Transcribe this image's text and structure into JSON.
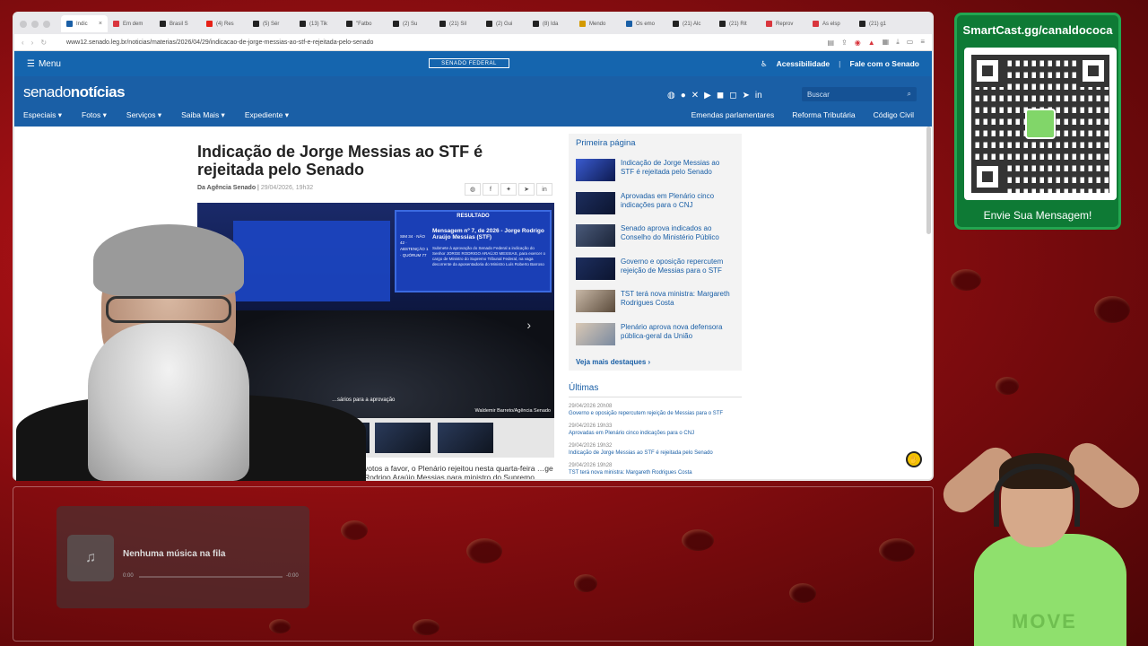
{
  "browser": {
    "tabs": [
      {
        "label": "Indic",
        "color": "#1a5fa6",
        "active": true
      },
      {
        "label": "Em dem",
        "color": "#d9363e"
      },
      {
        "label": "Brasil S",
        "color": "#222"
      },
      {
        "label": "(4) Res",
        "color": "#e62117"
      },
      {
        "label": "(5) Sér",
        "color": "#222"
      },
      {
        "label": "(13) Tik",
        "color": "#222"
      },
      {
        "label": "\"Fatbo",
        "color": "#222"
      },
      {
        "label": "(2) Su",
        "color": "#222"
      },
      {
        "label": "(21) Sil",
        "color": "#222"
      },
      {
        "label": "(2) Gui",
        "color": "#222"
      },
      {
        "label": "(8) Ida",
        "color": "#222"
      },
      {
        "label": "Mendo",
        "color": "#d49a00"
      },
      {
        "label": "Os emo",
        "color": "#1a5fa6"
      },
      {
        "label": "(21) Alc",
        "color": "#222"
      },
      {
        "label": "(21) Rit",
        "color": "#222"
      },
      {
        "label": "Reprov",
        "color": "#d9363e"
      },
      {
        "label": "As elsp",
        "color": "#d9363e"
      },
      {
        "label": "(21) g1",
        "color": "#222"
      }
    ],
    "tab_close": "×",
    "url": "www12.senado.leg.br/noticias/materias/2026/04/29/indicacao-de-jorge-messias-ao-stf-e-rejeitada-pelo-senado"
  },
  "senado": {
    "menu_label": "Menu",
    "center_logo": "SENADO FEDERAL",
    "accessibility": "Acessibilidade",
    "contact": "Fale com o Senado",
    "brand_left": "senado",
    "brand_right": "notícias",
    "nav_left": [
      "Especiais ▾",
      "Fotos ▾",
      "Serviços ▾",
      "Saiba Mais ▾",
      "Expediente ▾"
    ],
    "nav_right": [
      "Emendas parlamentares",
      "Reforma Tributária",
      "Código Civil"
    ],
    "search_placeholder": "Buscar",
    "social_icons": [
      "whatsapp-icon",
      "facebook-icon",
      "x-icon",
      "youtube-icon",
      "flickr-icon",
      "instagram-icon",
      "telegram-icon",
      "linkedin-icon"
    ]
  },
  "article": {
    "headline": "Indicação de Jorge Messias ao STF é rejeitada pelo Senado",
    "byline_source": "Da Agência Senado",
    "byline_date": "29/04/2026, 19h32",
    "photo_screen_title": "RESULTADO",
    "photo_screen_message": "Mensagem nº 7, de 2026 - Jorge Rodrigo Araújo Messias (STF)",
    "photo_screen_body": "Submete à aprovação do Senado Federal a indicação do Senhor JORGE RODRIGO ARAÚJO MESSIAS, para exercer o cargo de Ministro do Supremo Tribunal Federal, na vaga decorrente da aposentadoria do Ministro Luís Roberto Barroso",
    "photo_votes": "SIM 34 · NÃO 42 · ABSTENÇÃO 1 · QUÓRUM 77",
    "photo_caption": "…sários para a aprovação",
    "photo_credit": "Waldemir Barreto/Agência Senado",
    "lede": "votos a favor, o Plenário rejeitou nesta quarta-feira …ge Rodrigo Araújo Messias para ministro do Supremo"
  },
  "sidebar": {
    "title": "Primeira página",
    "items": [
      "Indicação de Jorge Messias ao STF é rejeitada pelo Senado",
      "Aprovadas em Plenário cinco indicações para o CNJ",
      "Senado aprova indicados ao Conselho do Ministério Público",
      "Governo e oposição repercutem rejeição de Messias para o STF",
      "TST terá nova ministra: Margareth Rodrigues Costa",
      "Plenário aprova nova defensora pública-geral da União"
    ],
    "more": "Veja mais destaques ›"
  },
  "ultimas": {
    "title": "Últimas",
    "items": [
      {
        "ts": "29/04/2026 20h08",
        "text": "Governo e oposição repercutem rejeição de Messias para o STF"
      },
      {
        "ts": "29/04/2026 19h33",
        "text": "Aprovadas em Plenário cinco indicações para o CNJ"
      },
      {
        "ts": "29/04/2026 19h32",
        "text": "Indicação de Jorge Messias ao STF é rejeitada pelo Senado"
      },
      {
        "ts": "29/04/2026 19h28",
        "text": "TST terá nova ministra: Margareth Rodrigues Costa"
      }
    ]
  },
  "smartcast": {
    "url": "SmartCast.gg/canaldococa",
    "cta": "Envie Sua Mensagem!"
  },
  "player": {
    "title": "Nenhuma música na fila",
    "time_elapsed": "0:00",
    "time_total": "-0:00",
    "progress": 0
  },
  "guest_shirt_text": "MOVE",
  "colors": {
    "senado_blue": "#1a5fa6",
    "smartcast_green": "#0e7a35",
    "background_red": "#c8141a"
  }
}
